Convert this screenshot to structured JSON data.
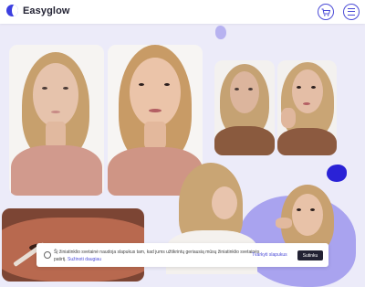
{
  "header": {
    "brand": "Easyglow",
    "icons": {
      "logo": "easyglow-logo-icon",
      "cart": "cart-icon",
      "menu": "hamburger-menu-icon"
    }
  },
  "colors": {
    "background": "#ecebf9",
    "accent": "#4b4bd7",
    "dark_blob": "#2a22d6",
    "light_blob": "#a9a3ef"
  },
  "cookie_banner": {
    "text": "Šį žiniatinklio svetainė naudoja slapukus tam, kad jums užtikrintų geriausią mūsų žiniatinklio svetainės patirtį.",
    "more_link": "Sužinoti daugiau",
    "settings_link": "Tvarkyti slapukus",
    "accept_button": "Sutinku"
  }
}
